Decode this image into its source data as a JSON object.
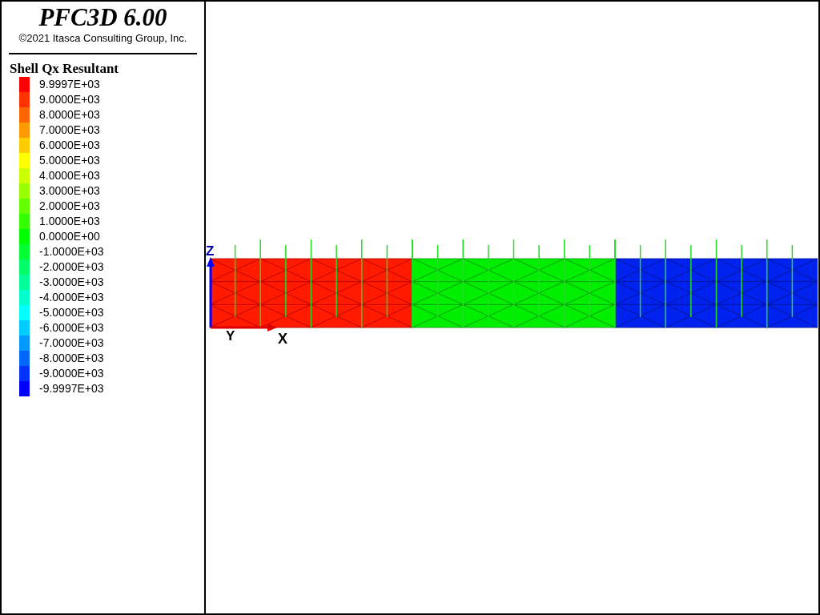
{
  "header": {
    "title": "PFC3D 6.00",
    "copyright": "©2021 Itasca Consulting Group, Inc."
  },
  "legend": {
    "title": "Shell Qx Resultant",
    "entries": [
      {
        "label": "9.9997E+03",
        "color": "#ff0000"
      },
      {
        "label": "9.0000E+03",
        "color": "#ff3300"
      },
      {
        "label": "8.0000E+03",
        "color": "#ff6600"
      },
      {
        "label": "7.0000E+03",
        "color": "#ff9900"
      },
      {
        "label": "6.0000E+03",
        "color": "#ffcc00"
      },
      {
        "label": "5.0000E+03",
        "color": "#ffff00"
      },
      {
        "label": "4.0000E+03",
        "color": "#ccff00"
      },
      {
        "label": "3.0000E+03",
        "color": "#99ff00"
      },
      {
        "label": "2.0000E+03",
        "color": "#66ff00"
      },
      {
        "label": "1.0000E+03",
        "color": "#33ff00"
      },
      {
        "label": "0.0000E+00",
        "color": "#00ff00"
      },
      {
        "label": "-1.0000E+03",
        "color": "#00ff33"
      },
      {
        "label": "-2.0000E+03",
        "color": "#00ff66"
      },
      {
        "label": "-3.0000E+03",
        "color": "#00ff99"
      },
      {
        "label": "-4.0000E+03",
        "color": "#00ffcc"
      },
      {
        "label": "-5.0000E+03",
        "color": "#00ffff"
      },
      {
        "label": "-6.0000E+03",
        "color": "#00ccff"
      },
      {
        "label": "-7.0000E+03",
        "color": "#0099ff"
      },
      {
        "label": "-8.0000E+03",
        "color": "#0066ff"
      },
      {
        "label": "-9.0000E+03",
        "color": "#0033ff"
      },
      {
        "label": "-9.9997E+03",
        "color": "#0000ff"
      }
    ]
  },
  "plot": {
    "axes": {
      "z_label": "Z",
      "y_label": "Y",
      "x_label": "X"
    }
  }
}
